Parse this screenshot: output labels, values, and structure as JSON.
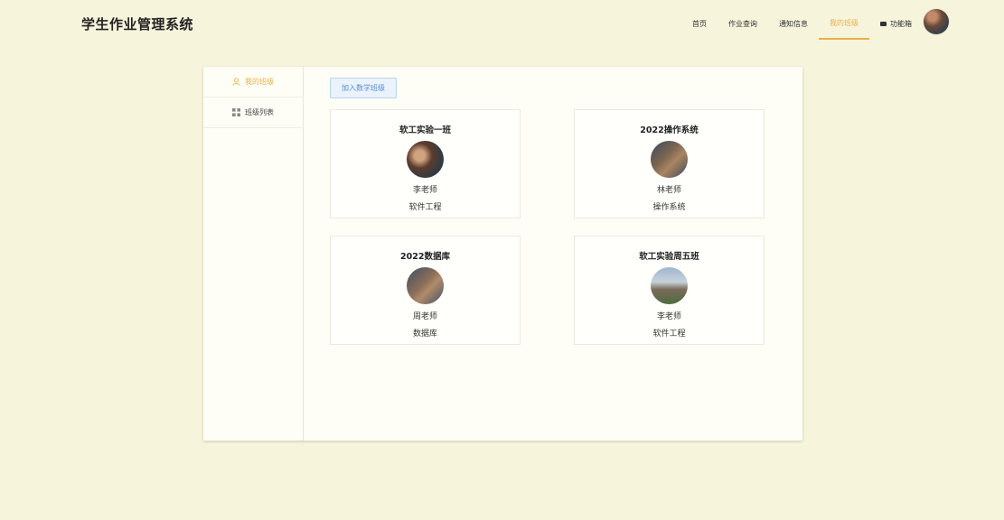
{
  "app": {
    "title": "学生作业管理系统"
  },
  "nav": {
    "items": [
      {
        "label": "首页"
      },
      {
        "label": "作业查询"
      },
      {
        "label": "通知信息"
      },
      {
        "label": "我的班级"
      },
      {
        "label": "功能箱"
      }
    ],
    "active": "我的班级"
  },
  "sidebar": {
    "items": [
      {
        "label": "我的班级",
        "icon": "user-icon"
      },
      {
        "label": "班级列表",
        "icon": "grid-icon"
      }
    ]
  },
  "main": {
    "join_button": "加入数学班级",
    "classes": [
      {
        "title": "软工实验一班",
        "teacher": "李老师",
        "subject": "软件工程"
      },
      {
        "title": "2022操作系统",
        "teacher": "林老师",
        "subject": "操作系统"
      },
      {
        "title": "2022数据库",
        "teacher": "周老师",
        "subject": "数据库"
      },
      {
        "title": "软工实验周五班",
        "teacher": "李老师",
        "subject": "软件工程"
      }
    ]
  },
  "colors": {
    "accent": "#e8b14a",
    "page_bg": "#f7f4dc",
    "button_blue": "#5a8fcf"
  }
}
